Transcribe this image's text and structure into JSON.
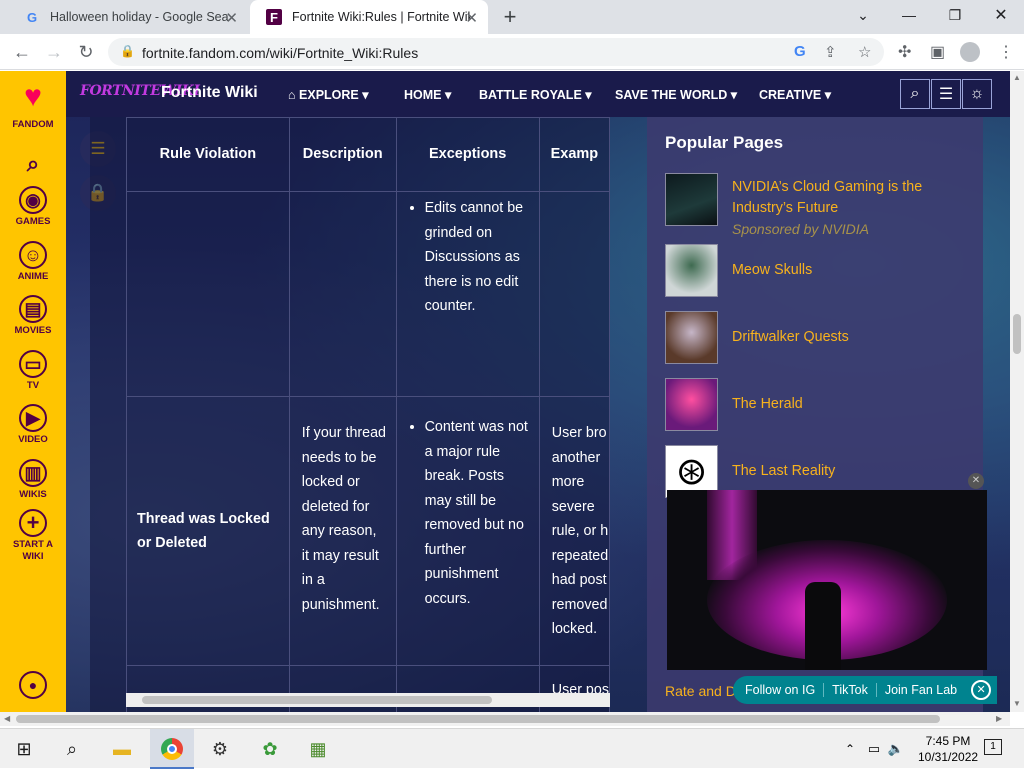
{
  "browser": {
    "tabs": [
      {
        "title": "Halloween holiday - Google Sear",
        "favicon": "G"
      },
      {
        "title": "Fortnite Wiki:Rules | Fortnite Wik",
        "favicon": "F"
      }
    ],
    "url": "fortnite.fandom.com/wiki/Fortnite_Wiki:Rules"
  },
  "fandom_rail": {
    "logo": "FANDOM",
    "items": [
      "GAMES",
      "ANIME",
      "MOVIES",
      "TV",
      "VIDEO",
      "WIKIS"
    ],
    "start_wiki": "START A WIKI"
  },
  "wiki_header": {
    "logo_text": "FORTNITEWIKI",
    "name": "Fortnite Wiki",
    "menu": [
      "EXPLORE",
      "HOME",
      "BATTLE ROYALE",
      "SAVE THE WORLD",
      "CREATIVE"
    ]
  },
  "table": {
    "headers": [
      "Rule Violation",
      "Description",
      "Exceptions",
      "Examp"
    ],
    "row1": {
      "exceptions": [
        "Edits cannot be grinded on Discussions as there is no edit counter."
      ]
    },
    "row2": {
      "violation": "Thread was Locked or Deleted",
      "description": "If your thread needs to be locked or deleted for any reason, it may result in a punishment.",
      "exceptions": [
        "Content was not a major rule break. Posts may still be removed but no further punishment occurs."
      ],
      "example_lines": [
        "User bro",
        "another",
        "more",
        "severe",
        "rule, or h",
        "repeated",
        "had post",
        "removed",
        "locked."
      ]
    },
    "row3_example": "User pos"
  },
  "popular_pages": {
    "title": "Popular Pages",
    "items": [
      {
        "title": "NVIDIA’s Cloud Gaming is the Industry’s Future",
        "sponsor": "Sponsored by NVIDIA"
      },
      {
        "title": "Meow Skulls"
      },
      {
        "title": "Driftwalker Quests"
      },
      {
        "title": "The Herald"
      },
      {
        "title": "The Last Reality"
      }
    ]
  },
  "fan_bar": {
    "links": [
      "Follow on IG",
      "TikTok",
      "Join Fan Lab"
    ]
  },
  "rate_text": "Rate and D",
  "taskbar": {
    "time": "7:45 PM",
    "date": "10/31/2022",
    "notifications": "1"
  },
  "colors": {
    "fandom_yellow": "#ffc500",
    "link_orange": "#f7b21d",
    "header_navy": "#1a1b4b",
    "fanlab_teal": "#00838f"
  }
}
